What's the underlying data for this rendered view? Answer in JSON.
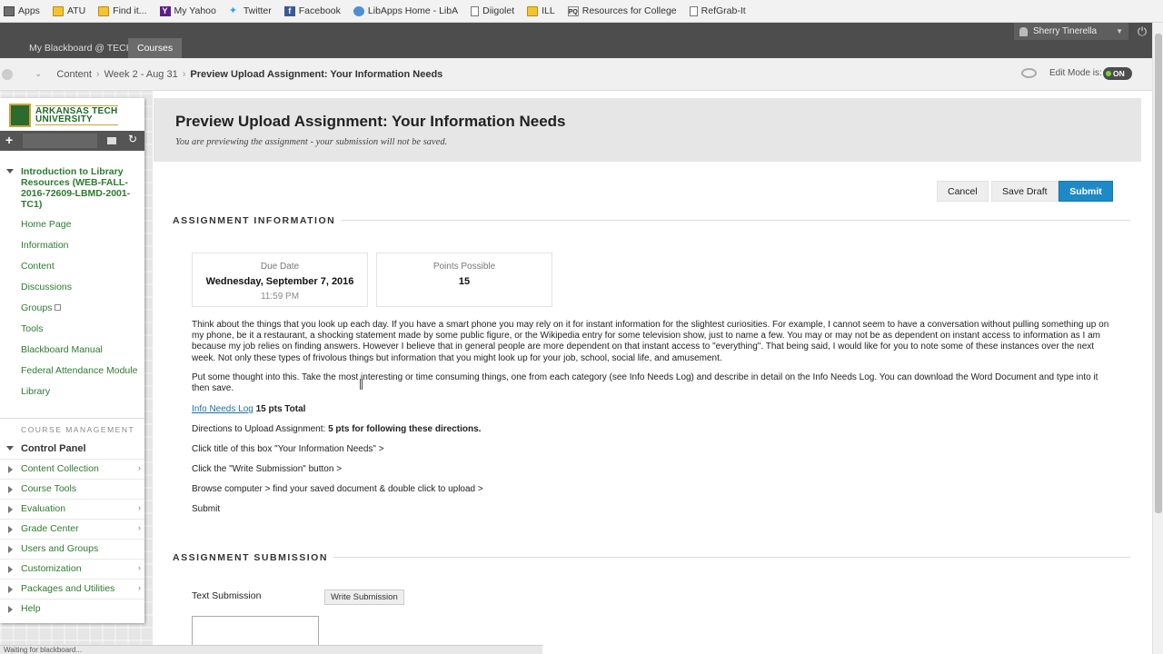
{
  "bookmarks": [
    {
      "label": "Apps",
      "icon": "apps-grid-icon"
    },
    {
      "label": "ATU",
      "icon": "folder-icon"
    },
    {
      "label": "Find it...",
      "icon": "folder-icon"
    },
    {
      "label": "My Yahoo",
      "icon": "yahoo-icon"
    },
    {
      "label": "Twitter",
      "icon": "twitter-icon"
    },
    {
      "label": "Facebook",
      "icon": "facebook-icon"
    },
    {
      "label": "LibApps Home - LibA",
      "icon": "libapps-icon"
    },
    {
      "label": "Diigolet",
      "icon": "page-icon"
    },
    {
      "label": "ILL",
      "icon": "folder-icon"
    },
    {
      "label": "Resources for College",
      "icon": "pq-icon"
    },
    {
      "label": "RefGrab-It",
      "icon": "page-icon"
    }
  ],
  "topnav": {
    "tabs": [
      "My Blackboard @ TECH",
      "Courses"
    ],
    "user": "Sherry Tinerella"
  },
  "breadcrumb": {
    "items": [
      "Content",
      "Week 2 - Aug 31",
      "Preview Upload Assignment: Your Information Needs"
    ],
    "edit_mode_label": "Edit Mode is:",
    "edit_mode_state": "ON"
  },
  "sidebar": {
    "logo_line1": "ARKANSAS TECH",
    "logo_line2": "UNIVERSITY",
    "course_title": "Introduction to Library Resources (WEB-FALL-2016-72609-LBMD-2001-TC1)",
    "links": [
      "Home Page",
      "Information",
      "Content",
      "Discussions",
      "Groups",
      "Tools",
      "Blackboard Manual",
      "Federal Attendance Module",
      "Library"
    ],
    "course_management_label": "COURSE MANAGEMENT",
    "control_panel_label": "Control Panel",
    "control_panel_items": [
      {
        "label": "Content Collection",
        "more": "›"
      },
      {
        "label": "Course Tools",
        "more": ""
      },
      {
        "label": "Evaluation",
        "more": "›"
      },
      {
        "label": "Grade Center",
        "more": "›"
      },
      {
        "label": "Users and Groups",
        "more": ""
      },
      {
        "label": "Customization",
        "more": "›"
      },
      {
        "label": "Packages and Utilities",
        "more": "›"
      },
      {
        "label": "Help",
        "more": ""
      }
    ]
  },
  "main": {
    "title": "Preview Upload Assignment: Your Information Needs",
    "subtitle": "You are previewing the assignment - your submission will not be saved.",
    "buttons": {
      "cancel": "Cancel",
      "save_draft": "Save Draft",
      "submit": "Submit"
    },
    "assignment_info_heading": "ASSIGNMENT INFORMATION",
    "due": {
      "label": "Due Date",
      "date": "Wednesday, September 7, 2016",
      "time": "11:59 PM"
    },
    "points": {
      "label": "Points Possible",
      "value": "15"
    },
    "paragraph1": "Think about the things that you look up each day. If you have a smart phone you may rely on it for instant information for the slightest curiosities. For example, I cannot seem to have a conversation without pulling something up on my phone, be it a restaurant, a shocking statement made by some public figure, or the Wikipedia entry for some television show, just to name a few. You may or may not be as dependent on instant access to information as I am because my job relies on finding answers. However I believe that in general people are more dependent on that instant access to \"everything\". That being said, I would like for you to note some of these instances over the next week. Not only these types of frivolous things but information that you might look up for your job, school, social life, and amusement.",
    "paragraph2": "Put some thought into this. Take the most interesting or time consuming things, one from each category (see Info Needs Log) and describe in detail on the Info Needs Log.  You can download the Word Document and type into it then save.",
    "info_log_link": "Info Needs Log",
    "info_log_total": " 15 pts Total",
    "directions_prefix": "Directions to Upload Assignment: ",
    "directions_bold": "5 pts for following these directions.",
    "steps": [
      "Click title of this box \"Your Information Needs\" >",
      "Click the \"Write Submission\" button >",
      "Browse computer > find your saved document & double click to upload >",
      "Submit"
    ],
    "assignment_submission_heading": "ASSIGNMENT SUBMISSION",
    "text_submission_label": "Text Submission",
    "write_submission_button": "Write Submission"
  },
  "status_text": "Waiting for blackboard..."
}
